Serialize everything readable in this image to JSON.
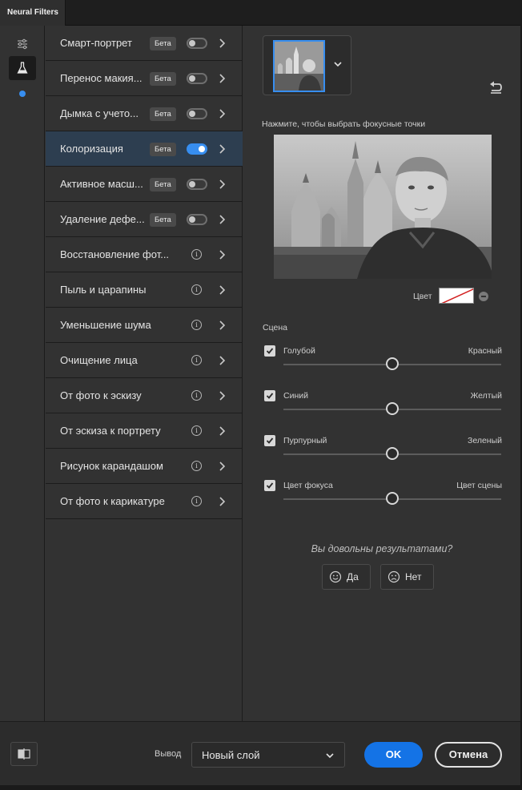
{
  "window": {
    "tab_title": "Neural Filters"
  },
  "filters": [
    {
      "label": "Смарт-портрет",
      "beta": "Бета",
      "toggle": "off"
    },
    {
      "label": "Перенос макия...",
      "beta": "Бета",
      "toggle": "off"
    },
    {
      "label": "Дымка с учето...",
      "beta": "Бета",
      "toggle": "off"
    },
    {
      "label": "Колоризация",
      "beta": "Бета",
      "toggle": "on",
      "selected": true
    },
    {
      "label": "Активное масш...",
      "beta": "Бета",
      "toggle": "off"
    },
    {
      "label": "Удаление дефе...",
      "beta": "Бета",
      "toggle": "off"
    },
    {
      "label": "Восстановление фот...",
      "info": "i"
    },
    {
      "label": "Пыль и царапины",
      "info": "i"
    },
    {
      "label": "Уменьшение шума",
      "info": "i"
    },
    {
      "label": "Очищение лица",
      "info": "i"
    },
    {
      "label": "От фото к эскизу",
      "info": "i"
    },
    {
      "label": "От эскиза к портрету",
      "info": "i"
    },
    {
      "label": "Рисунок карандашом",
      "info": "i"
    },
    {
      "label": "От фото к карикатуре",
      "info": "i"
    }
  ],
  "panel": {
    "focus_hint": "Нажмите, чтобы выбрать фокусные точки",
    "color_label": "Цвет",
    "scene_label": "Сцена",
    "sliders": [
      {
        "left": "Голубой",
        "right": "Красный",
        "checked": true,
        "value": 0.5
      },
      {
        "left": "Синий",
        "right": "Желтый",
        "checked": true,
        "value": 0.5
      },
      {
        "left": "Пурпурный",
        "right": "Зеленый",
        "checked": true,
        "value": 0.5
      },
      {
        "left": "Цвет фокуса",
        "right": "Цвет сцены",
        "checked": true,
        "value": 0.5
      }
    ],
    "feedback_question": "Вы довольны результатами?",
    "feedback_yes": "Да",
    "feedback_no": "Нет"
  },
  "footer": {
    "output_label": "Вывод",
    "output_value": "Новый слой",
    "ok_label": "OK",
    "cancel_label": "Отмена"
  },
  "colors": {
    "accent": "#378ef0",
    "ok_button": "#1473e6",
    "panel_bg": "#323232",
    "selected_row": "#2d3e50"
  }
}
